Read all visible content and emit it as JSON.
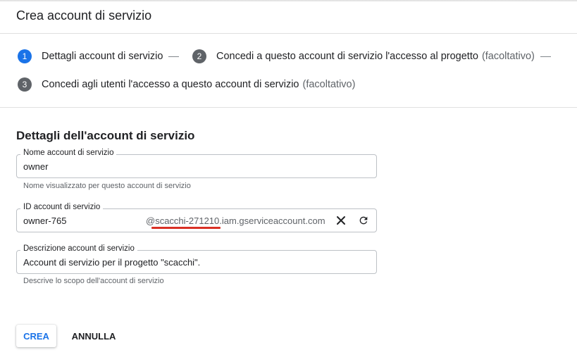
{
  "page": {
    "title": "Crea account di servizio"
  },
  "stepper": {
    "steps": [
      {
        "number": "1",
        "label": "Dettagli account di servizio",
        "optional": "",
        "active": true
      },
      {
        "number": "2",
        "label": "Concedi a questo account di servizio l'accesso al progetto",
        "optional": "(facoltativo)",
        "active": false
      },
      {
        "number": "3",
        "label": "Concedi agli utenti l'accesso a questo account di servizio",
        "optional": "(facoltativo)",
        "active": false
      }
    ]
  },
  "form": {
    "section_title": "Dettagli dell'account di servizio",
    "name_field": {
      "label": "Nome account di servizio",
      "value": "owner",
      "helper": "Nome visualizzato per questo account di servizio"
    },
    "id_field": {
      "label": "ID account di servizio",
      "value": "owner-765",
      "suffix": "@scacchi-271210.iam.gserviceaccount.com",
      "clear_icon": "close-icon",
      "refresh_icon": "refresh-icon"
    },
    "description_field": {
      "label": "Descrizione account di servizio",
      "value": "Account di servizio per il progetto \"scacchi\".",
      "helper": "Descrive lo scopo dell'account di servizio"
    }
  },
  "actions": {
    "create_label": "CREA",
    "cancel_label": "ANNULLA"
  },
  "colors": {
    "accent": "#1a73e8",
    "annotation": "#d93025",
    "step_inactive": "#5f6368"
  }
}
